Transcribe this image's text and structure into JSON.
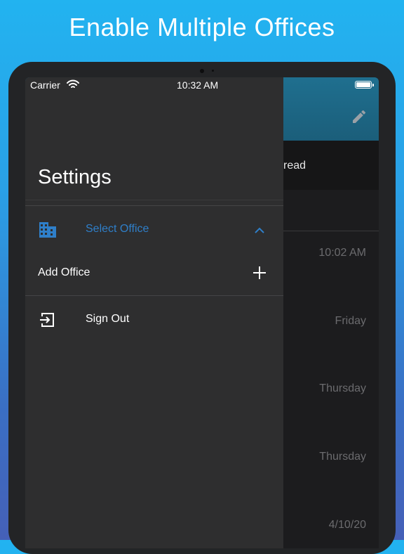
{
  "headline": "Enable Multiple Offices",
  "status_bar": {
    "carrier": "Carrier",
    "time": "10:32 AM"
  },
  "drawer": {
    "title": "Settings",
    "select_office": "Select Office",
    "add_office": "Add Office",
    "sign_out": "Sign Out"
  },
  "background": {
    "tab_label": "read",
    "times": [
      "10:02 AM",
      "Friday",
      "Thursday",
      "Thursday",
      "4/10/20"
    ]
  },
  "colors": {
    "accent": "#2f7fc9",
    "drawer_bg": "#2e2e2f",
    "header": "#1f6f8f"
  },
  "icons": [
    "wifi-icon",
    "battery-icon",
    "pencil-icon",
    "building-icon",
    "chevron-up-icon",
    "plus-icon",
    "sign-out-icon"
  ]
}
